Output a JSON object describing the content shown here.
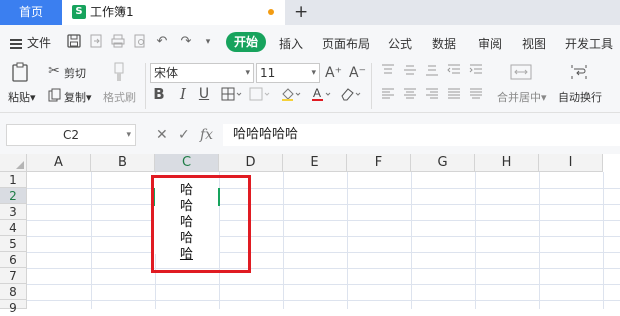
{
  "tabs": {
    "home": "首页",
    "workbook": "工作簿1",
    "close": "×",
    "new_tab": "+"
  },
  "menu": {
    "file": "文件",
    "start": "开始",
    "items": [
      "插入",
      "页面布局",
      "公式",
      "数据",
      "审阅",
      "视图",
      "开发工具"
    ]
  },
  "ribbon": {
    "paste": "粘贴",
    "cut": "剪切",
    "copy": "复制",
    "format_painter": "格式刷",
    "font_name": "宋体",
    "font_size": "11",
    "bold": "B",
    "italic": "I",
    "underline": "U",
    "merge_center": "合并居中",
    "wrap_text": "自动换行"
  },
  "formula_bar": {
    "name_box": "C2",
    "cancel": "✕",
    "confirm": "✓",
    "fx": "fx",
    "value": "哈哈哈哈哈"
  },
  "grid": {
    "columns": [
      "A",
      "B",
      "C",
      "D",
      "E",
      "F",
      "G",
      "H",
      "I"
    ],
    "rows": [
      "1",
      "2",
      "3",
      "4",
      "5",
      "6",
      "7",
      "8",
      "9"
    ],
    "selected_column": "C",
    "selected_row": "2",
    "cell_c2_lines": [
      "哈",
      "哈",
      "哈",
      "哈",
      "哈"
    ]
  },
  "colors": {
    "accent_green": "#17a35d",
    "home_tab_blue": "#3b7ff0",
    "highlight_red": "#e01b22"
  }
}
